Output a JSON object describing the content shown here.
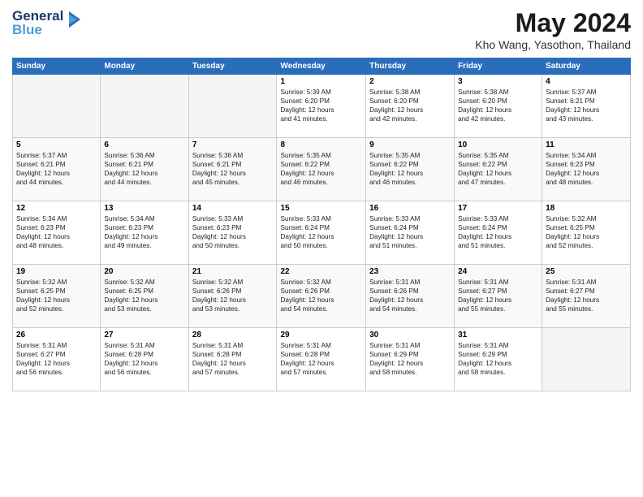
{
  "logo": {
    "line1": "General",
    "line2": "Blue"
  },
  "title": "May 2024",
  "subtitle": "Kho Wang, Yasothon, Thailand",
  "days_header": [
    "Sunday",
    "Monday",
    "Tuesday",
    "Wednesday",
    "Thursday",
    "Friday",
    "Saturday"
  ],
  "weeks": [
    [
      {
        "num": "",
        "info": ""
      },
      {
        "num": "",
        "info": ""
      },
      {
        "num": "",
        "info": ""
      },
      {
        "num": "1",
        "info": "Sunrise: 5:39 AM\nSunset: 6:20 PM\nDaylight: 12 hours\nand 41 minutes."
      },
      {
        "num": "2",
        "info": "Sunrise: 5:38 AM\nSunset: 6:20 PM\nDaylight: 12 hours\nand 42 minutes."
      },
      {
        "num": "3",
        "info": "Sunrise: 5:38 AM\nSunset: 6:20 PM\nDaylight: 12 hours\nand 42 minutes."
      },
      {
        "num": "4",
        "info": "Sunrise: 5:37 AM\nSunset: 6:21 PM\nDaylight: 12 hours\nand 43 minutes."
      }
    ],
    [
      {
        "num": "5",
        "info": "Sunrise: 5:37 AM\nSunset: 6:21 PM\nDaylight: 12 hours\nand 44 minutes."
      },
      {
        "num": "6",
        "info": "Sunrise: 5:36 AM\nSunset: 6:21 PM\nDaylight: 12 hours\nand 44 minutes."
      },
      {
        "num": "7",
        "info": "Sunrise: 5:36 AM\nSunset: 6:21 PM\nDaylight: 12 hours\nand 45 minutes."
      },
      {
        "num": "8",
        "info": "Sunrise: 5:35 AM\nSunset: 6:22 PM\nDaylight: 12 hours\nand 46 minutes."
      },
      {
        "num": "9",
        "info": "Sunrise: 5:35 AM\nSunset: 6:22 PM\nDaylight: 12 hours\nand 46 minutes."
      },
      {
        "num": "10",
        "info": "Sunrise: 5:35 AM\nSunset: 6:22 PM\nDaylight: 12 hours\nand 47 minutes."
      },
      {
        "num": "11",
        "info": "Sunrise: 5:34 AM\nSunset: 6:23 PM\nDaylight: 12 hours\nand 48 minutes."
      }
    ],
    [
      {
        "num": "12",
        "info": "Sunrise: 5:34 AM\nSunset: 6:23 PM\nDaylight: 12 hours\nand 48 minutes."
      },
      {
        "num": "13",
        "info": "Sunrise: 5:34 AM\nSunset: 6:23 PM\nDaylight: 12 hours\nand 49 minutes."
      },
      {
        "num": "14",
        "info": "Sunrise: 5:33 AM\nSunset: 6:23 PM\nDaylight: 12 hours\nand 50 minutes."
      },
      {
        "num": "15",
        "info": "Sunrise: 5:33 AM\nSunset: 6:24 PM\nDaylight: 12 hours\nand 50 minutes."
      },
      {
        "num": "16",
        "info": "Sunrise: 5:33 AM\nSunset: 6:24 PM\nDaylight: 12 hours\nand 51 minutes."
      },
      {
        "num": "17",
        "info": "Sunrise: 5:33 AM\nSunset: 6:24 PM\nDaylight: 12 hours\nand 51 minutes."
      },
      {
        "num": "18",
        "info": "Sunrise: 5:32 AM\nSunset: 6:25 PM\nDaylight: 12 hours\nand 52 minutes."
      }
    ],
    [
      {
        "num": "19",
        "info": "Sunrise: 5:32 AM\nSunset: 6:25 PM\nDaylight: 12 hours\nand 52 minutes."
      },
      {
        "num": "20",
        "info": "Sunrise: 5:32 AM\nSunset: 6:25 PM\nDaylight: 12 hours\nand 53 minutes."
      },
      {
        "num": "21",
        "info": "Sunrise: 5:32 AM\nSunset: 6:26 PM\nDaylight: 12 hours\nand 53 minutes."
      },
      {
        "num": "22",
        "info": "Sunrise: 5:32 AM\nSunset: 6:26 PM\nDaylight: 12 hours\nand 54 minutes."
      },
      {
        "num": "23",
        "info": "Sunrise: 5:31 AM\nSunset: 6:26 PM\nDaylight: 12 hours\nand 54 minutes."
      },
      {
        "num": "24",
        "info": "Sunrise: 5:31 AM\nSunset: 6:27 PM\nDaylight: 12 hours\nand 55 minutes."
      },
      {
        "num": "25",
        "info": "Sunrise: 5:31 AM\nSunset: 6:27 PM\nDaylight: 12 hours\nand 55 minutes."
      }
    ],
    [
      {
        "num": "26",
        "info": "Sunrise: 5:31 AM\nSunset: 6:27 PM\nDaylight: 12 hours\nand 56 minutes."
      },
      {
        "num": "27",
        "info": "Sunrise: 5:31 AM\nSunset: 6:28 PM\nDaylight: 12 hours\nand 56 minutes."
      },
      {
        "num": "28",
        "info": "Sunrise: 5:31 AM\nSunset: 6:28 PM\nDaylight: 12 hours\nand 57 minutes."
      },
      {
        "num": "29",
        "info": "Sunrise: 5:31 AM\nSunset: 6:28 PM\nDaylight: 12 hours\nand 57 minutes."
      },
      {
        "num": "30",
        "info": "Sunrise: 5:31 AM\nSunset: 6:29 PM\nDaylight: 12 hours\nand 58 minutes."
      },
      {
        "num": "31",
        "info": "Sunrise: 5:31 AM\nSunset: 6:29 PM\nDaylight: 12 hours\nand 58 minutes."
      },
      {
        "num": "",
        "info": ""
      }
    ]
  ]
}
